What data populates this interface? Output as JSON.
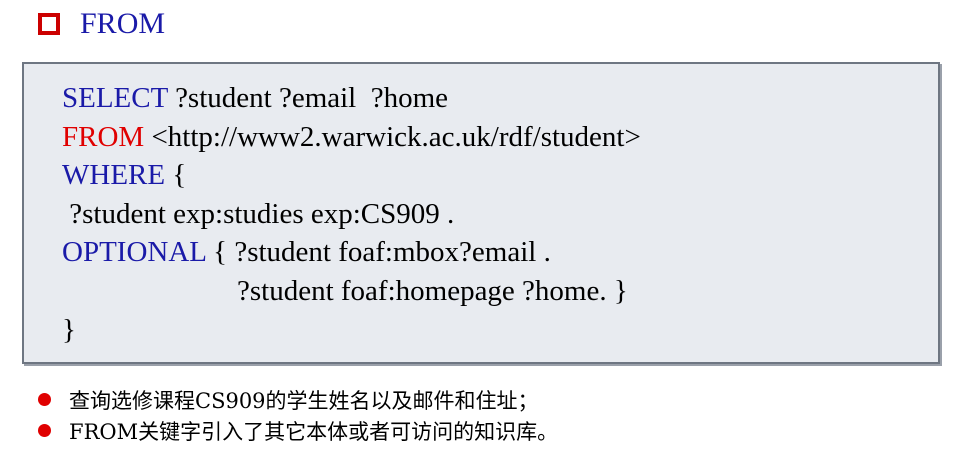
{
  "heading": {
    "text": "FROM"
  },
  "code": {
    "line1": {
      "keyword": "SELECT",
      "rest": " ?student ?email  ?home"
    },
    "line2": {
      "keyword": "FROM",
      "rest": " <http://www2.warwick.ac.uk/rdf/student>"
    },
    "line3": {
      "keyword": "WHERE",
      "rest": " {"
    },
    "line4": {
      "text": " ?student exp:studies exp:CS909 ."
    },
    "line5": {
      "keyword": "OPTIONAL",
      "rest": " { ?student foaf:mbox?email ."
    },
    "line6": {
      "text": "?student foaf:homepage ?home. }"
    },
    "line7": {
      "text": "}"
    }
  },
  "bullets": [
    {
      "text": "查询选修课程CS909的学生姓名以及邮件和住址；"
    },
    {
      "text": "FROM关键字引入了其它本体或者可访问的知识库。"
    }
  ],
  "colors": {
    "blue": "#1a1aa8",
    "red": "#e00000",
    "box_bg": "#e8ebf0"
  }
}
